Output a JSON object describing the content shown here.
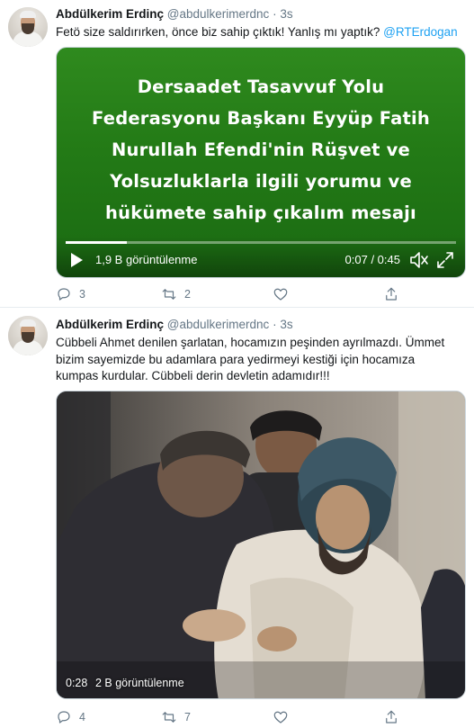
{
  "tweets": [
    {
      "author": {
        "name": "Abdülkerim Erdinç",
        "handle": "@abdulkerimerdnc",
        "dot": "·",
        "time": "3s"
      },
      "text_before": "Fetö size saldırırken, önce biz sahip çıktık! Yanlış mı yaptık? ",
      "mention": "@RTErdogan",
      "video": {
        "title_lines": [
          "Dersaadet Tasavvuf Yolu",
          "Federasyonu Başkanı Eyyüp Fatih",
          "Nurullah Efendi'nin Rüşvet ve",
          "Yolsuzluklarla ilgili yorumu ve",
          "hükümete sahip çıkalım mesajı"
        ],
        "views": "1,9 B görüntülenme",
        "time": "0:07 / 0:45",
        "progress": 0.156,
        "background_color": "#237a16"
      },
      "stats": {
        "replies": "3",
        "retweets": "2"
      }
    },
    {
      "author": {
        "name": "Abdülkerim Erdinç",
        "handle": "@abdulkerimerdnc",
        "dot": "·",
        "time": "3s"
      },
      "text": "Cübbeli Ahmet denilen şarlatan, hocamızın peşinden ayrılmazdı. Ümmet bizim sayemizde bu adamlara para yedirmeyi kestiği için hocamıza kumpas kurdular. Cübbeli derin devletin adamıdır!!!",
      "video": {
        "duration": "0:28",
        "views": "2 B görüntülenme"
      },
      "stats": {
        "replies": "4",
        "retweets": "7"
      }
    }
  ],
  "icons": [
    "reply-icon",
    "retweet-icon",
    "like-icon",
    "share-icon",
    "play-icon",
    "volume-icon",
    "fullscreen-icon"
  ],
  "colors": {
    "link": "#1da1f2",
    "secondary_text": "#657786",
    "divider": "#e6ecf0"
  }
}
